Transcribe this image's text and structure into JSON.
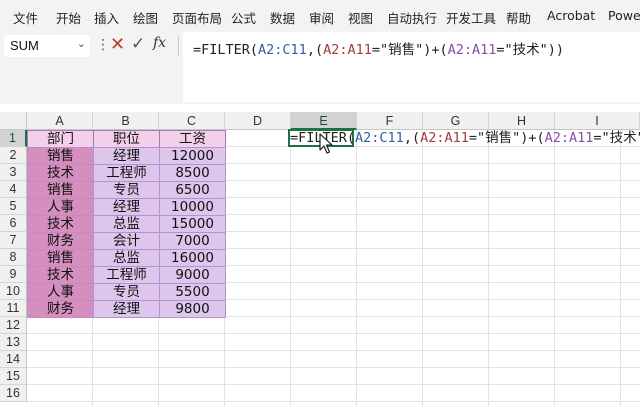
{
  "menu": {
    "items": [
      "文件",
      "开始",
      "插入",
      "绘图",
      "页面布局",
      "公式",
      "数据",
      "审阅",
      "视图",
      "自动执行",
      "开发工具",
      "帮助",
      "Acrobat",
      "Power"
    ]
  },
  "formula_bar": {
    "name_box": "SUM",
    "fx_label": "fx",
    "formula_parts": [
      {
        "text": "=FILTER(",
        "color": "#222222"
      },
      {
        "text": "A2:C11",
        "color": "#2e5fa8"
      },
      {
        "text": ",(",
        "color": "#222222"
      },
      {
        "text": "A2:A11",
        "color": "#a33c3c"
      },
      {
        "text": "=\"销售\")+(",
        "color": "#222222"
      },
      {
        "text": "A2:A11",
        "color": "#8a4fa3"
      },
      {
        "text": "=\"技术\"))",
        "color": "#222222"
      }
    ]
  },
  "grid": {
    "columns": [
      "A",
      "B",
      "C",
      "D",
      "E",
      "F",
      "G",
      "H",
      "I"
    ],
    "rows": [
      "1",
      "2",
      "3",
      "4",
      "5",
      "6",
      "7",
      "8",
      "9",
      "10",
      "11",
      "12",
      "13",
      "14",
      "15",
      "16"
    ],
    "selected_column": "E",
    "selected_row": "1",
    "headers": [
      "部门",
      "职位",
      "工资"
    ],
    "data": [
      [
        "销售",
        "经理",
        "12000"
      ],
      [
        "技术",
        "工程师",
        "8500"
      ],
      [
        "销售",
        "专员",
        "6500"
      ],
      [
        "人事",
        "经理",
        "10000"
      ],
      [
        "技术",
        "总监",
        "15000"
      ],
      [
        "财务",
        "会计",
        "7000"
      ],
      [
        "销售",
        "总监",
        "16000"
      ],
      [
        "技术",
        "工程师",
        "9000"
      ],
      [
        "人事",
        "专员",
        "5500"
      ],
      [
        "财务",
        "经理",
        "9800"
      ]
    ]
  },
  "active_cell": {
    "ref": "E1",
    "parts": [
      {
        "text": "=FILTER(",
        "color": "#222222"
      },
      {
        "text": "A2:C11",
        "color": "#2e5fa8"
      },
      {
        "text": ",(",
        "color": "#222222"
      },
      {
        "text": "A2:A11",
        "color": "#a33c3c"
      },
      {
        "text": "=\"销售\")+(",
        "color": "#222222"
      },
      {
        "text": "A2:A11",
        "color": "#8a4fa3"
      },
      {
        "text": "=\"技术\"))",
        "color": "#222222"
      }
    ]
  },
  "icons": {
    "name_box_dropdown": "chevron-down-icon",
    "more": "vertical-dots-icon",
    "cancel": "close-icon",
    "enter": "check-icon",
    "cursor": "mouse-pointer-icon"
  },
  "colors": {
    "header_fill": "#f3d0ea",
    "category_fill": "#d58fbf",
    "data_fill": "#dec5eb",
    "selection": "#1e7145"
  }
}
